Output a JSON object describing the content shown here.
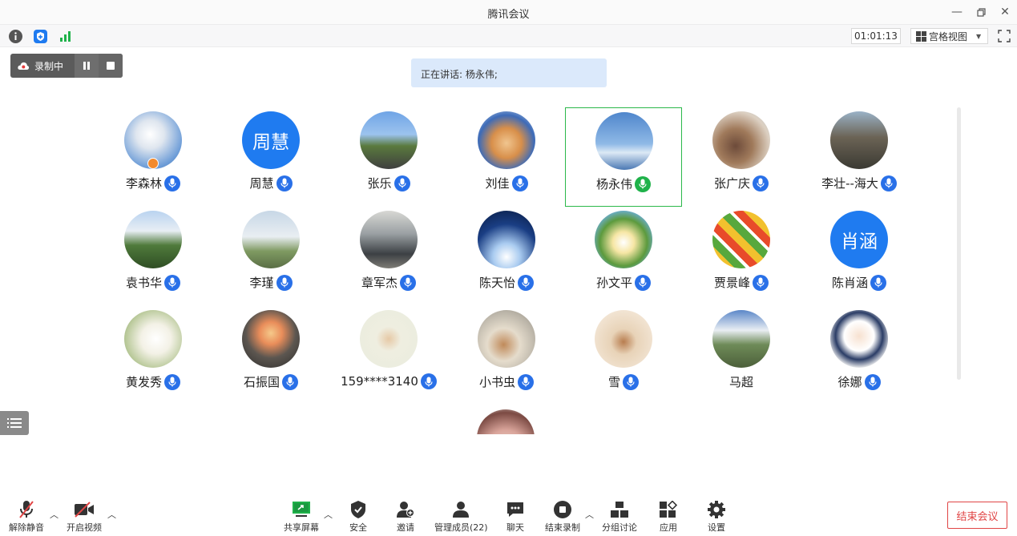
{
  "window": {
    "title": "腾讯会议"
  },
  "status": {
    "timer": "01:01:13",
    "view_label": "宫格视图"
  },
  "recording": {
    "label": "录制中"
  },
  "speaking": {
    "prefix": "正在讲话: ",
    "names": "杨永伟;"
  },
  "participants": [
    {
      "name": "李森林",
      "avatar": "photo",
      "mic": "blue",
      "host": true
    },
    {
      "name": "周慧",
      "avatar": "text",
      "avatar_text": "周慧",
      "mic": "blue"
    },
    {
      "name": "张乐",
      "avatar": "photo",
      "mic": "blue"
    },
    {
      "name": "刘佳",
      "avatar": "photo",
      "mic": "blue"
    },
    {
      "name": "杨永伟",
      "avatar": "photo",
      "mic": "green",
      "active": true
    },
    {
      "name": "张广庆",
      "avatar": "photo",
      "mic": "blue"
    },
    {
      "name": "李壮--海大",
      "avatar": "photo",
      "mic": "blue"
    },
    {
      "name": "袁书华",
      "avatar": "photo",
      "mic": "blue"
    },
    {
      "name": "李瑾",
      "avatar": "photo",
      "mic": "blue"
    },
    {
      "name": "章军杰",
      "avatar": "photo",
      "mic": "blue"
    },
    {
      "name": "陈天怡",
      "avatar": "photo",
      "mic": "blue"
    },
    {
      "name": "孙文平",
      "avatar": "photo",
      "mic": "blue"
    },
    {
      "name": "贾景峰",
      "avatar": "photo",
      "mic": "blue"
    },
    {
      "name": "陈肖涵",
      "avatar": "text",
      "avatar_text": "肖涵",
      "mic": "blue"
    },
    {
      "name": "黄发秀",
      "avatar": "photo",
      "mic": "blue"
    },
    {
      "name": "石振国",
      "avatar": "photo",
      "mic": "blue"
    },
    {
      "name": "159****3140",
      "avatar": "photo",
      "mic": "blue"
    },
    {
      "name": "小书虫",
      "avatar": "photo",
      "mic": "blue"
    },
    {
      "name": "雪",
      "avatar": "photo",
      "mic": "blue"
    },
    {
      "name": "马超",
      "avatar": "photo",
      "mic": "none"
    },
    {
      "name": "徐娜",
      "avatar": "photo",
      "mic": "blue"
    }
  ],
  "toolbar": {
    "unmute": "解除静音",
    "video": "开启视频",
    "share": "共享屏幕",
    "security": "安全",
    "invite": "邀请",
    "members": "管理成员(22)",
    "chat": "聊天",
    "stop_record": "结束录制",
    "breakout": "分组讨论",
    "apps": "应用",
    "settings": "设置",
    "end": "结束会议"
  },
  "colors": {
    "accent_blue": "#1f7bf0",
    "active_green": "#2bb84a",
    "danger_red": "#e04545"
  }
}
